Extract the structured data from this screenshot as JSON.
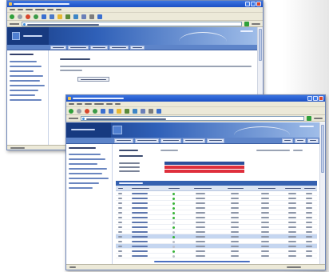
{
  "colors": {
    "title_top": "#3b74e0",
    "title_bottom": "#1a4fc4",
    "chrome": "#ece9d8",
    "banner_dark": "#173a80",
    "banner_mid": "#2f60b8",
    "banner_light": "#a3c0ea",
    "nav": "#5d84c9",
    "section": "#3561b0",
    "table_header": "#dde5f2",
    "selected_row": "#c5d6f0",
    "ok": "#37b337",
    "idle": "#b9bec8",
    "alert": "#df2f3c",
    "gauge_blue": "#2d4f9a",
    "link": "#4a6fc0"
  },
  "back_window": {
    "toolbar_icons": [
      {
        "name": "back-icon",
        "color": "#2fa03a"
      },
      {
        "name": "forward-icon",
        "color": "#9aa0a8"
      },
      {
        "name": "stop-icon",
        "color": "#d8472c"
      },
      {
        "name": "refresh-icon",
        "color": "#3c9b48"
      },
      {
        "name": "home-icon",
        "color": "#3a6fd0"
      },
      {
        "name": "search-icon",
        "color": "#4a78c8"
      },
      {
        "name": "favorites-icon",
        "color": "#e8b832"
      },
      {
        "name": "media-icon",
        "color": "#5a8a3a"
      },
      {
        "name": "history-icon",
        "color": "#3d86c6"
      },
      {
        "name": "mail-icon",
        "color": "#6b7fb8"
      },
      {
        "name": "print-icon",
        "color": "#7d7d7d"
      },
      {
        "name": "edit-icon",
        "color": "#3a6fd0"
      }
    ]
  },
  "front_window": {
    "toolbar_icons": [
      {
        "name": "back-icon",
        "color": "#2fa03a"
      },
      {
        "name": "forward-icon",
        "color": "#9aa0a8"
      },
      {
        "name": "stop-icon",
        "color": "#d8472c"
      },
      {
        "name": "refresh-icon",
        "color": "#3c9b48"
      },
      {
        "name": "home-icon",
        "color": "#3a6fd0"
      },
      {
        "name": "search-icon",
        "color": "#4a78c8"
      },
      {
        "name": "favorites-icon",
        "color": "#e8b832"
      },
      {
        "name": "media-icon",
        "color": "#5a8a3a"
      },
      {
        "name": "history-icon",
        "color": "#3d86c6"
      },
      {
        "name": "mail-icon",
        "color": "#6b7fb8"
      },
      {
        "name": "print-icon",
        "color": "#7d7d7d"
      },
      {
        "name": "edit-icon",
        "color": "#3a6fd0"
      }
    ],
    "gauges": [
      {
        "color": "#2d4f9a",
        "fill": 1
      },
      {
        "color": "#df2f3c",
        "fill": 1
      },
      {
        "color": "#df2f3c",
        "fill": 1
      }
    ],
    "table": {
      "rows": [
        {
          "status": "ok",
          "selected": false
        },
        {
          "status": "ok",
          "selected": false
        },
        {
          "status": "ok",
          "selected": false
        },
        {
          "status": "ok",
          "selected": false
        },
        {
          "status": "ok",
          "selected": false
        },
        {
          "status": "ok",
          "selected": false
        },
        {
          "status": "idle",
          "selected": false
        },
        {
          "status": "ok",
          "selected": false
        },
        {
          "status": "idle",
          "selected": false
        },
        {
          "status": "ok",
          "selected": true
        },
        {
          "status": "idle",
          "selected": false
        },
        {
          "status": "idle",
          "selected": true
        },
        {
          "status": "ok",
          "selected": false
        },
        {
          "status": "idle",
          "selected": false
        }
      ]
    }
  }
}
